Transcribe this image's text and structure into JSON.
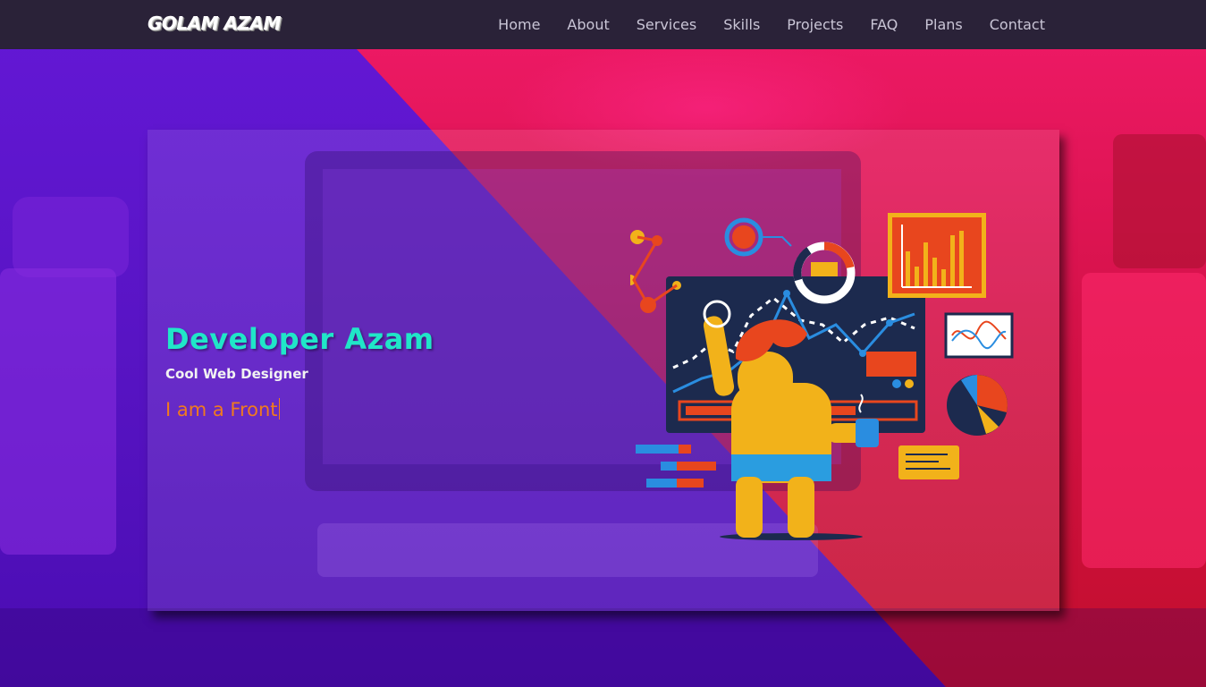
{
  "brand": {
    "logo_text": "GOLAM AZAM"
  },
  "nav": {
    "items": [
      {
        "label": "Home"
      },
      {
        "label": "About"
      },
      {
        "label": "Services"
      },
      {
        "label": "Skills"
      },
      {
        "label": "Projects"
      },
      {
        "label": "FAQ"
      },
      {
        "label": "Plans"
      },
      {
        "label": "Contact"
      }
    ]
  },
  "hero": {
    "title": "Developer Azam",
    "subtitle": "Cool Web Designer",
    "typed_text": "I am a Front"
  },
  "colors": {
    "navbar_bg": "#2a2238",
    "nav_text": "#c9c5d6",
    "title": "#20e6c8",
    "typed": "#f07a1e",
    "purple": "#5a14c8",
    "pink": "#e01a52"
  }
}
